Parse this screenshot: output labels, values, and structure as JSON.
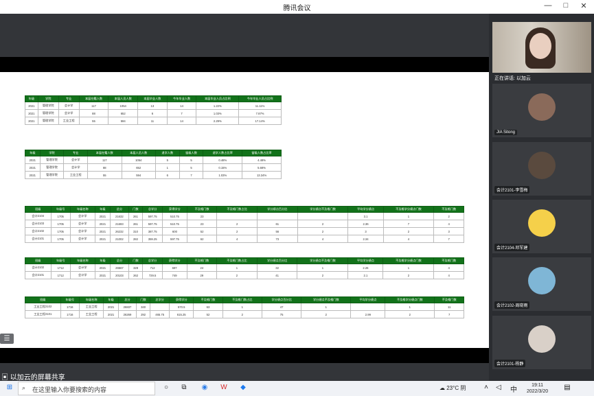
{
  "window": {
    "title": "腾讯会议",
    "controls": [
      "—",
      "□",
      "✕"
    ]
  },
  "share": {
    "label": "以加云的屏幕共享"
  },
  "tables": [
    {
      "headers": [
        "年级",
        "学院",
        "专业",
        "本届在籍人数",
        "本届人员人数",
        "本届毕业人数",
        "今年毕业人数",
        "本届毕业人员占比例",
        "今年毕业人员占比例"
      ],
      "rows": [
        [
          "2021",
          "管理学院",
          "会计学",
          "117",
          "1054",
          "13",
          "14",
          "1.22%",
          "11.11%"
        ],
        [
          "2021",
          "管理学院",
          "会计学",
          "88",
          "652",
          "6",
          "7",
          "1.03%",
          "7.87%"
        ],
        [
          "2021",
          "管理学院",
          "工业工程",
          "55",
          "594",
          "11",
          "14",
          "2.29%",
          "17.14%"
        ]
      ]
    },
    {
      "headers": [
        "年级",
        "学院",
        "专业",
        "本届在籍人数",
        "本届人员人数",
        "退学人数",
        "留级人数",
        "退学人数占比率",
        "留级人数占比率"
      ],
      "rows": [
        [
          "2021",
          "管理学院",
          "会计学",
          "117",
          "1054",
          "5",
          "5",
          "0.48%",
          "4.48%"
        ],
        [
          "2021",
          "管理学院",
          "会计学",
          "88",
          "652",
          "1",
          "5",
          "0.15%",
          "5.68%"
        ],
        [
          "2021",
          "管理学院",
          "工业工程",
          "55",
          "594",
          "6",
          "7",
          "1.03%",
          "13.34%"
        ]
      ]
    },
    {
      "headers": [
        "班级",
        "年级号",
        "年级名称",
        "年级",
        "总分",
        "门数",
        "总学分",
        "获得学分",
        "不及格门数",
        "不及格门数占比",
        "学分绩点百分比",
        "学分绩点不及格门数",
        "平均学分绩点",
        "不及格学分绩点门数",
        "不及格门数"
      ],
      "rows": [
        [
          "会计2104",
          "1705",
          "会计学",
          "2021",
          "21632",
          "261",
          "597.75",
          "510.75",
          "23",
          "",
          "",
          "",
          "3.1",
          "1",
          "2"
        ],
        [
          "会计2103",
          "1705",
          "会计学",
          "2021",
          "21693",
          "261",
          "597.75",
          "510.75",
          "23",
          "2",
          "61",
          "2",
          "2.36",
          "7",
          "4"
        ],
        [
          "会计2102",
          "1705",
          "会计学",
          "2021",
          "26232",
          "310",
          "387.75",
          "600",
          "52",
          "2",
          "56",
          "2",
          "3",
          "2",
          "3"
        ],
        [
          "会计2101",
          "1705",
          "会计学",
          "2021",
          "21002",
          "282",
          "359.25",
          "597.75",
          "62",
          "4",
          "73",
          "4",
          "2.34",
          "4",
          "7"
        ]
      ]
    },
    {
      "headers": [
        "班级",
        "年级号",
        "年级名称",
        "年级",
        "总分",
        "门数",
        "总学分",
        "获得学分",
        "不及格门数",
        "不及格门数占比",
        "学分绩点百分比",
        "学分绩点不及格门数",
        "平均学分绩点",
        "不及格学分绩点门数",
        "不及格门数"
      ],
      "rows": [
        [
          "会计2102",
          "1712",
          "会计学",
          "2021",
          "26567",
          "328",
          "712",
          "697",
          "24",
          "1",
          "32",
          "1",
          "2.26",
          "1",
          "4"
        ],
        [
          "会计2101",
          "1712",
          "会计学",
          "2021",
          "20103",
          "262",
          "729.5",
          "749",
          "29",
          "2",
          "41",
          "2",
          "2.1",
          "2",
          "4"
        ]
      ]
    },
    {
      "headers": [
        "班级",
        "年级号",
        "年级名称",
        "年级",
        "总分",
        "门数",
        "总学分",
        "获得学分",
        "不及格门数",
        "不及格门数占比",
        "学分绩点百分比",
        "学分绩点不及格门数",
        "平均学分绩点",
        "不及格学分绩点门数",
        "不及格门数"
      ],
      "rows": [
        [
          "工业工程2102",
          "1716",
          "工业工程",
          "2021",
          "26837",
          "340",
          "",
          "570.5",
          "63",
          "1",
          "47",
          "1",
          "",
          "1",
          "11"
        ],
        [
          "工业工程2101",
          "1716",
          "工业工程",
          "2021",
          "26269",
          "292",
          "465.75",
          "615.25",
          "52",
          "2",
          "75",
          "2",
          "2.99",
          "2",
          "7"
        ]
      ]
    }
  ],
  "participants": [
    {
      "name": "正在讲话: 以加云",
      "avatar_color": "#c9a58f"
    },
    {
      "name": "JIA Sitong",
      "avatar_color": "#8a6a5a"
    },
    {
      "name": "会计2101-李雪梅",
      "avatar_color": "#5a4a3e"
    },
    {
      "name": "会计2104-邓军建",
      "avatar_color": "#f5d04a"
    },
    {
      "name": "会计2102-周晓雨",
      "avatar_color": "#7fb6d6"
    },
    {
      "name": "会计2101-杨静",
      "avatar_color": "#d9d0c8"
    }
  ],
  "taskbar": {
    "search_placeholder": "在这里输入你要搜索的内容",
    "weather": "23°C 阴",
    "time": "19:11",
    "date": "2022/3/20"
  }
}
